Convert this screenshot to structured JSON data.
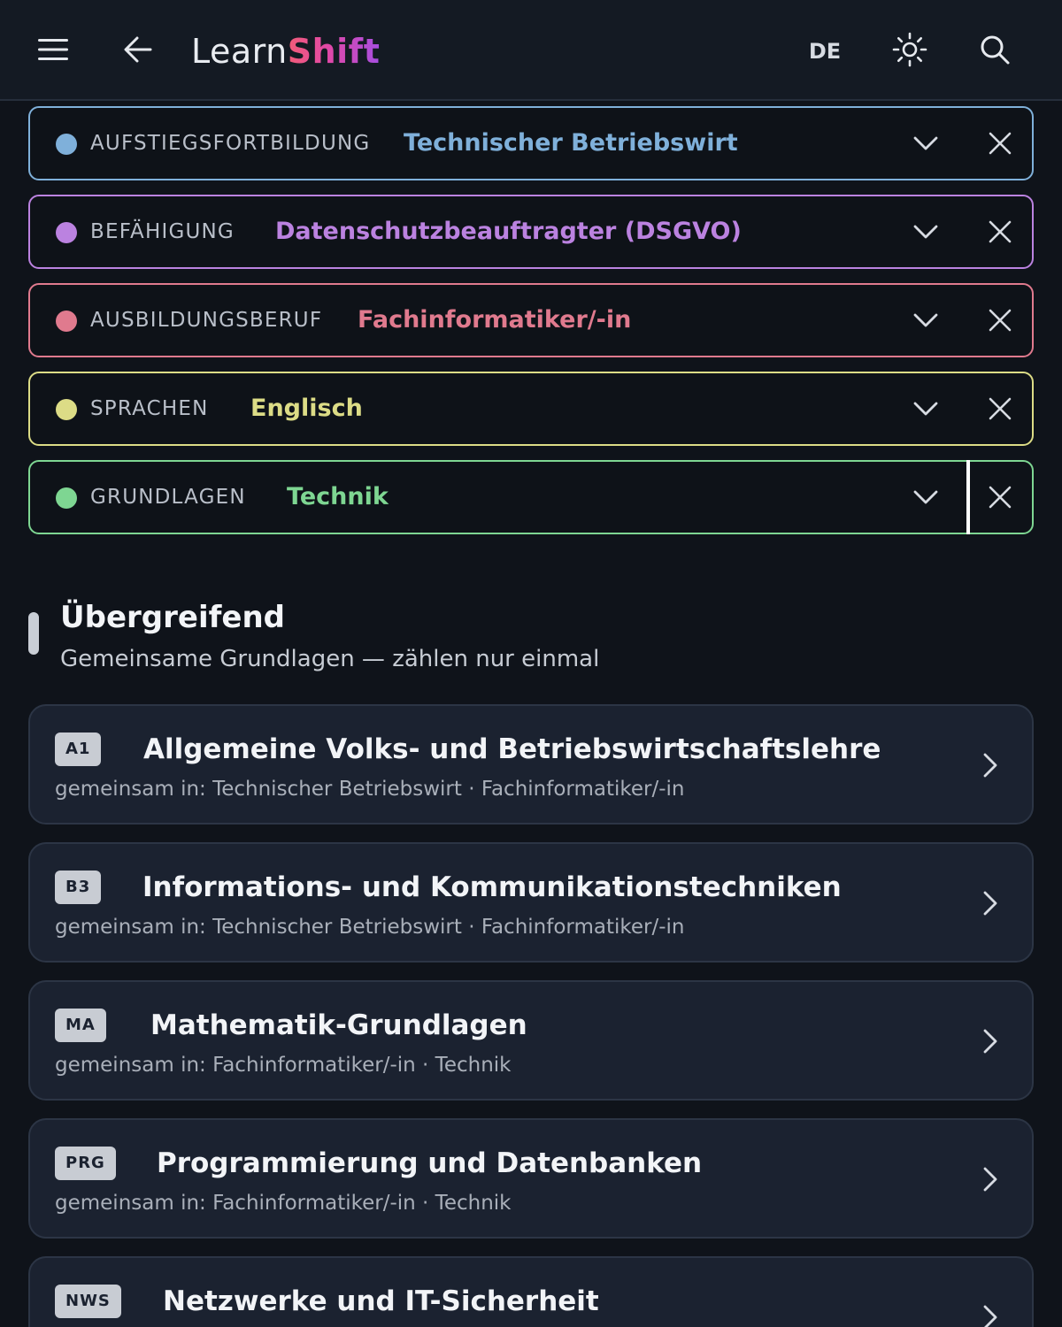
{
  "header": {
    "menu_icon": "menu-icon",
    "back_icon": "arrow-left-icon",
    "logo_part1": "Learn",
    "logo_part2": "Shift",
    "language": "DE",
    "theme_icon": "sun-icon",
    "search_icon": "search-icon"
  },
  "filters": [
    {
      "category": "AUFSTIEGSFORTBILDUNG",
      "value": "Technischer Betriebswirt",
      "color": "#7fb0da"
    },
    {
      "category": "BEFÄHIGUNG",
      "value": "Datenschutzbeauftragter (DSGVO)",
      "color": "#bb82e0"
    },
    {
      "category": "AUSBILDUNGSBERUF",
      "value": "Fachinformatiker/-in",
      "color": "#e07a8e"
    },
    {
      "category": "SPRACHEN",
      "value": "Englisch",
      "color": "#dcdc86"
    },
    {
      "category": "GRUNDLAGEN",
      "value": "Technik",
      "color": "#7ed692"
    }
  ],
  "section": {
    "title": "Übergreifend",
    "subtitle": "Gemeinsame Grundlagen — zählen nur einmal"
  },
  "cards": [
    {
      "code": "A1",
      "title": "Allgemeine Volks- und Betriebswirtschaftslehre",
      "shared": "gemeinsam in: Technischer Betriebswirt · Fachinformatiker/-in"
    },
    {
      "code": "B3",
      "title": "Informations- und Kommunikationstechniken",
      "shared": "gemeinsam in: Technischer Betriebswirt · Fachinformatiker/-in"
    },
    {
      "code": "MA",
      "title": "Mathematik-Grundlagen",
      "shared": "gemeinsam in: Fachinformatiker/-in · Technik"
    },
    {
      "code": "PRG",
      "title": "Programmierung und Datenbanken",
      "shared": "gemeinsam in: Fachinformatiker/-in · Technik"
    },
    {
      "code": "NWS",
      "title": "Netzwerke und IT-Sicherheit",
      "shared": ""
    }
  ]
}
